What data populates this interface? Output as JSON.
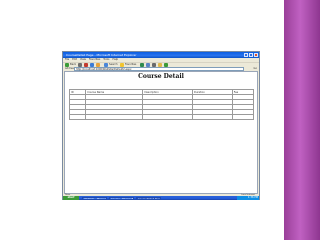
{
  "colors": {
    "decor_purple": "#b14fb3",
    "titlebar_blue": "#0a5ee3",
    "taskbar_blue": "#245edb",
    "start_green": "#3c9a38"
  },
  "window": {
    "title": "CourseDetail Page - Microsoft Internet Explorer",
    "menu": [
      "File",
      "Edit",
      "View",
      "Favorites",
      "Tools",
      "Help"
    ]
  },
  "toolbar": {
    "back_label": "Back",
    "search_label": "Search",
    "favorites_label": "Favorites"
  },
  "address": {
    "label": "Address",
    "url": "http://localhost:1000/WebSite/Default2.aspx",
    "go_label": "Go"
  },
  "page": {
    "title": "Course Detail",
    "table": {
      "headers": [
        "ID",
        "Course Name",
        "Description",
        "Duration",
        "Fee"
      ],
      "rows": [
        [
          "",
          "",
          "",
          "",
          ""
        ],
        [
          "",
          "",
          "",
          "",
          ""
        ],
        [
          "",
          "",
          "",
          "",
          ""
        ],
        [
          "",
          "",
          "",
          "",
          ""
        ],
        [
          "",
          "",
          "",
          "",
          ""
        ]
      ]
    }
  },
  "status": {
    "text": "Done",
    "zone": "Local intranet"
  },
  "taskbar": {
    "start": "start",
    "tasks": [
      "WebSite - Microsoft...",
      "Course - Microsoft Word",
      "CourseDetail Page..."
    ],
    "clock": "1:36 PM"
  }
}
